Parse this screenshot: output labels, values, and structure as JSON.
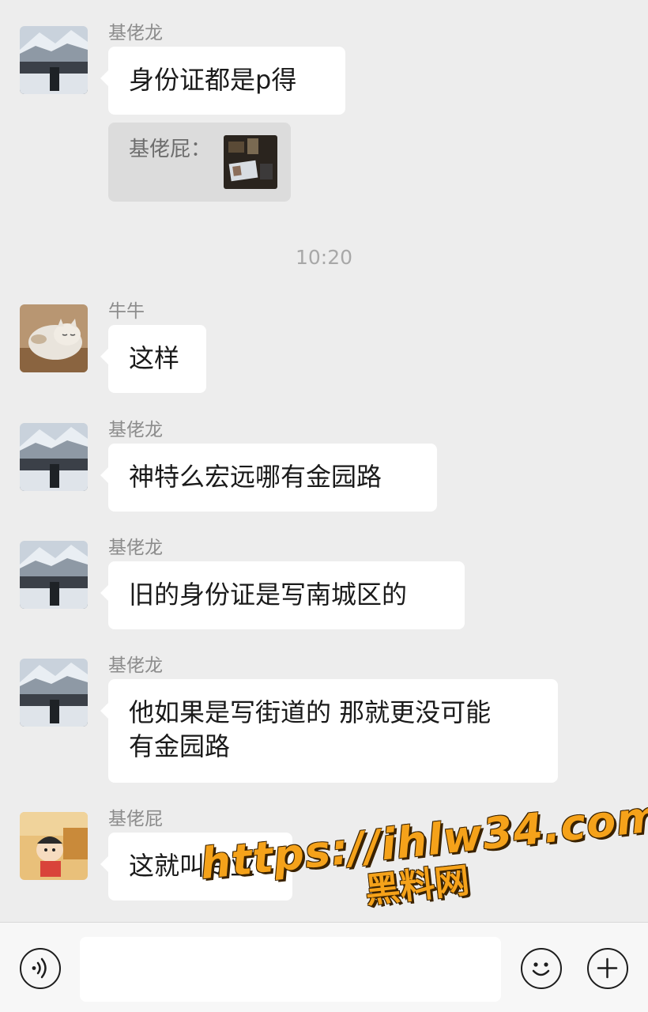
{
  "chat": {
    "messages": [
      {
        "sender": "基佬龙",
        "text": "身份证都是p得",
        "avatar": "mountain-avatar",
        "quote": {
          "text": "基佬屁：",
          "thumb": "photo-thumbnail"
        }
      },
      {
        "sender": "牛牛",
        "text": "这样",
        "avatar": "cat-avatar"
      },
      {
        "sender": "基佬龙",
        "text": "神特么宏远哪有金园路",
        "avatar": "mountain-avatar"
      },
      {
        "sender": "基佬龙",
        "text": "旧的身份证是写南城区的",
        "avatar": "mountain-avatar"
      },
      {
        "sender": "基佬龙",
        "text_line1": "他如果是写街道的 那就更没可能",
        "text_line2": "有金园路",
        "avatar": "mountain-avatar"
      },
      {
        "sender": "基佬屁",
        "text": "这就叫专业",
        "avatar": "cartoon-avatar"
      }
    ],
    "timestamp": "10:20"
  },
  "input_bar": {
    "voice_icon": "voice-icon",
    "emoji_icon": "emoji-icon",
    "plus_icon": "plus-icon",
    "input_value": ""
  },
  "watermark": {
    "line1": "https://ihlw34.com",
    "line2": "黑料网"
  },
  "colors": {
    "background": "#ededed",
    "bubble": "#ffffff",
    "sender_text": "#8c8c8c",
    "watermark": "#f5a21a"
  }
}
